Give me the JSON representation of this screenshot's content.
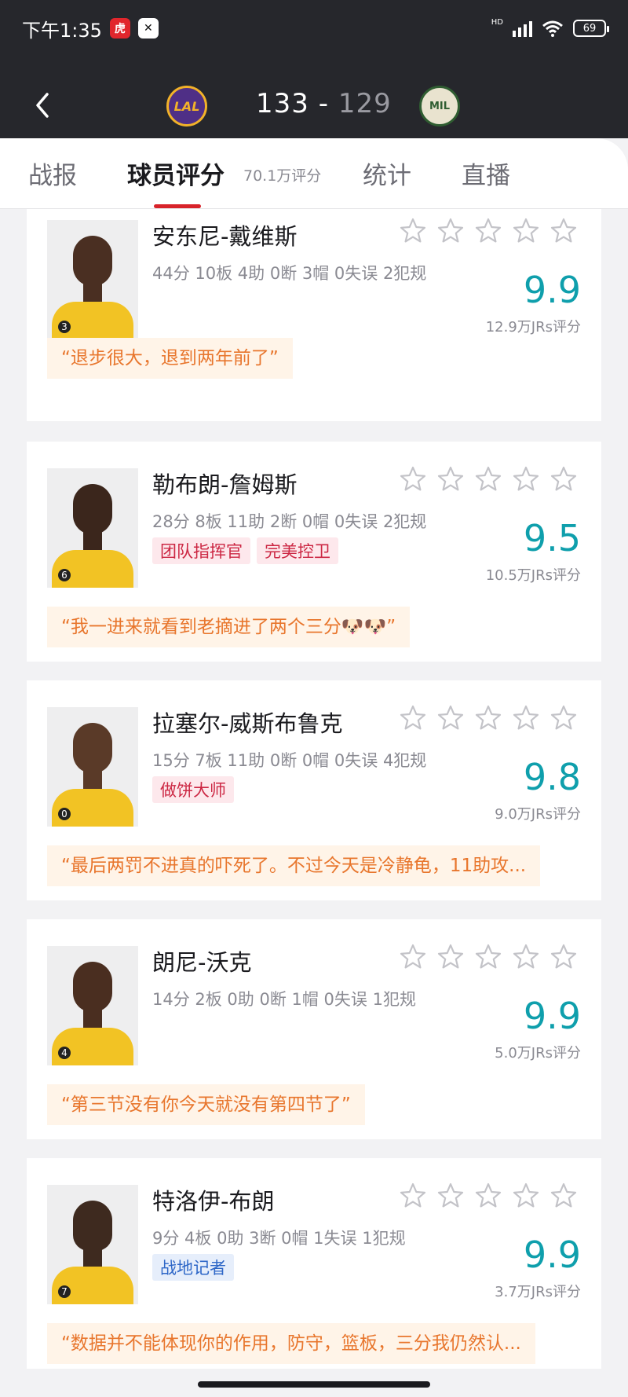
{
  "status_bar": {
    "time": "下午1:35",
    "app_icon_1": "虎扑",
    "app_icon_2": "剪映",
    "signal_label": "HD",
    "battery": "69"
  },
  "match": {
    "home_team": "LAL",
    "away_team": "MIL",
    "home_score": "133",
    "separator": "-",
    "away_score": "129"
  },
  "tabs": {
    "report": "战报",
    "player_rating": "球员评分",
    "rating_count": "70.1万评分",
    "stats": "统计",
    "live": "直播"
  },
  "players": [
    {
      "name": "安东尼-戴维斯",
      "stats": "44分 10板 4助 0断 3帽 0失误 2犯规",
      "tags": [],
      "rating": "9.9",
      "rating_count": "12.9万JRs评分",
      "quote": "“退步很大，退到两年前了”"
    },
    {
      "name": "勒布朗-詹姆斯",
      "stats": "28分 8板 11助 2断 0帽 0失误 2犯规",
      "tags": [
        "团队指挥官",
        "完美控卫"
      ],
      "rating": "9.5",
      "rating_count": "10.5万JRs评分",
      "quote": "“我一进来就看到老摘进了两个三分🐶🐶”"
    },
    {
      "name": "拉塞尔-威斯布鲁克",
      "stats": "15分 7板 11助 0断 0帽 0失误 4犯规",
      "tags": [
        "做饼大师"
      ],
      "rating": "9.8",
      "rating_count": "9.0万JRs评分",
      "quote": "“最后两罚不进真的吓死了。不过今天是冷静龟，11助攻..."
    },
    {
      "name": "朗尼-沃克",
      "stats": "14分 2板 0助 0断 1帽 0失误 1犯规",
      "tags": [],
      "rating": "9.9",
      "rating_count": "5.0万JRs评分",
      "quote": "“第三节没有你今天就没有第四节了”"
    },
    {
      "name": "特洛伊-布朗",
      "stats": "9分 4板 0助 3断 0帽 1失误 1犯规",
      "tags": [
        "战地记者"
      ],
      "rating": "9.9",
      "rating_count": "3.7万JRs评分",
      "quote": "“数据并不能体现你的作用，防守，篮板，三分我仍然认..."
    }
  ],
  "colors": {
    "header_bg": "#26272c",
    "accent_red": "#d8232a",
    "rating_teal": "#0f9fac",
    "quote_orange": "#e8762d",
    "tag_red": "#cc2743",
    "tag_blue": "#2d66c7"
  },
  "icons": {
    "back": "chevron-left-icon",
    "star": "star-outline-icon"
  }
}
